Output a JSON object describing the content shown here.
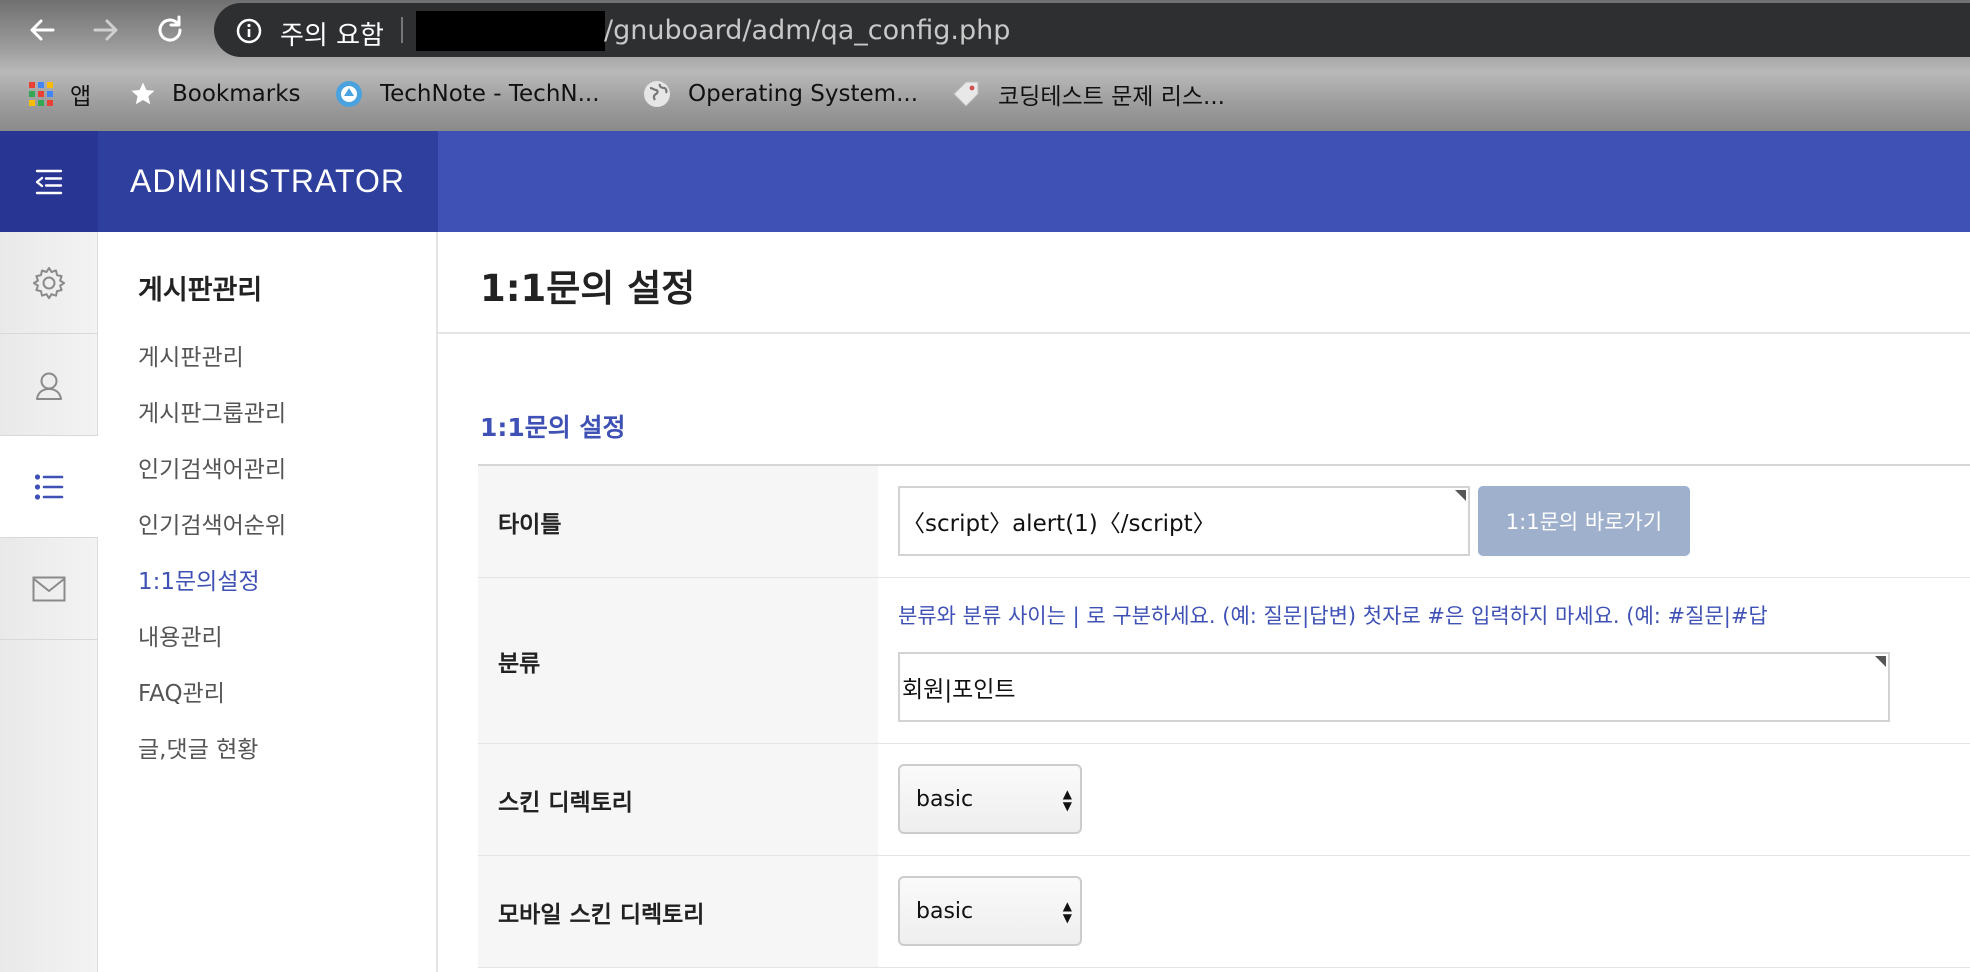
{
  "browser": {
    "security_label": "주의 요함",
    "url_path": "/gnuboard/adm/qa_config.php",
    "bookmarks": [
      {
        "label": "앱",
        "icon": "apps-grid-icon"
      },
      {
        "label": "Bookmarks",
        "icon": "star-icon"
      },
      {
        "label": "TechNote - TechN...",
        "icon": "technote-icon"
      },
      {
        "label": "Operating System...",
        "icon": "globe-icon"
      },
      {
        "label": "코딩테스트 문제 리스...",
        "icon": "tag-icon"
      }
    ]
  },
  "header": {
    "brand": "ADMINISTRATOR",
    "accent": "#3f51b5"
  },
  "iconbar": [
    {
      "icon": "gear-icon",
      "active": false
    },
    {
      "icon": "user-icon",
      "active": false
    },
    {
      "icon": "list-icon",
      "active": true
    },
    {
      "icon": "mail-icon",
      "active": false
    }
  ],
  "submenu": {
    "title": "게시판관리",
    "items": [
      {
        "label": "게시판관리",
        "active": false
      },
      {
        "label": "게시판그룹관리",
        "active": false
      },
      {
        "label": "인기검색어관리",
        "active": false
      },
      {
        "label": "인기검색어순위",
        "active": false
      },
      {
        "label": "1:1문의설정",
        "active": true
      },
      {
        "label": "내용관리",
        "active": false
      },
      {
        "label": "FAQ관리",
        "active": false
      },
      {
        "label": "글,댓글 현황",
        "active": false
      }
    ]
  },
  "main": {
    "page_title": "1:1문의 설정",
    "section_title": "1:1문의 설정",
    "form": {
      "title_label": "타이틀",
      "title_value": "〈script〉alert(1)〈/script〉",
      "shortcut_button": "1:1문의 바로가기",
      "category_label": "분류",
      "category_help": "분류와 분류 사이는 | 로 구분하세요. (예: 질문|답변) 첫자로 #은 입력하지 마세요. (예: #질문|#답",
      "category_value": "회원|포인트",
      "skin_label": "스킨 디렉토리",
      "skin_value": "basic",
      "mobile_skin_label": "모바일 스킨 디렉토리",
      "mobile_skin_value": "basic"
    }
  }
}
